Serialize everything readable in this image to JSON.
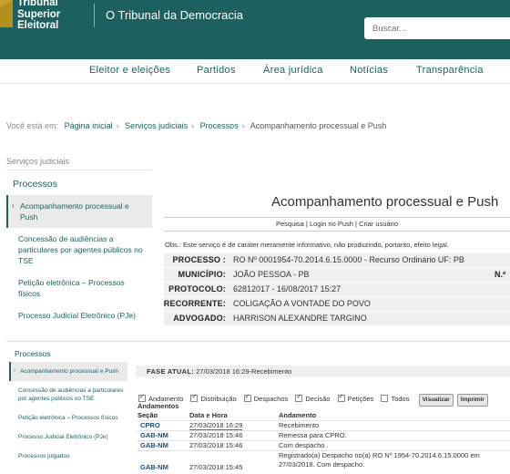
{
  "header": {
    "logo_lines": [
      "Tribunal",
      "Superior",
      "Eleitoral"
    ],
    "tagline": "O Tribunal da Democracia",
    "search_placeholder": "Buscar..."
  },
  "nav": [
    "Eleitor e eleições",
    "Partidos",
    "Área jurídica",
    "Notícias",
    "Transparência"
  ],
  "breadcrumb": {
    "prefix": "Você está em:",
    "items": [
      "Página inicial",
      "Serviços judiciais",
      "Processos",
      "Acompanhamento processual e Push"
    ]
  },
  "sidebar": {
    "section": "Serviços judiciais",
    "title": "Processos",
    "items": [
      "Acompanhamento processual e Push",
      "Concessão de audiências a particulares por agentes públicos no TSE",
      "Petição eletrônica – Processos físicos",
      "Processo Judicial Eletrônico (PJe)"
    ]
  },
  "main": {
    "title": "Acompanhamento processual e Push",
    "links": [
      "Pesquisa",
      "Login no Push",
      "Criar usuário"
    ],
    "obs": "Obs.: Este serviço é de caráter meramente informativo, não produzindo, portanto, efeito legal.",
    "rows": [
      {
        "label": "PROCESSO :",
        "value": "RO Nº 0001954-70.2014.6.15.0000 - Recurso Ordinário UF: PB"
      },
      {
        "label": "MUNICÍPIO:",
        "value": "JOÃO PESSOA - PB",
        "extra": "N.º"
      },
      {
        "label": "PROTOCOLO:",
        "value": "62812017 - 16/08/2017 15:27"
      },
      {
        "label": "RECORRENTE:",
        "value": "COLIGAÇÃO A VONTADE DO POVO"
      },
      {
        "label": "ADVOGADO:",
        "value": "HARRISON ALEXANDRE TARGINO"
      }
    ]
  },
  "lower": {
    "title": "Processos",
    "items": [
      "Acompanhamento processual e Push",
      "Concessão de audiências a particulares por agentes públicos no TSE",
      "Petição eletrônica – Processos físicos",
      "Processo Judicial Eletrônico (PJe)",
      "Processos julgados"
    ],
    "fase_label": "FASE ATUAL:",
    "fase_value": "27/03/2018 16:29-Recebimento",
    "filters": [
      "Andamento",
      "Distribuição",
      "Despachos",
      "Decisão",
      "Petições",
      "Todos"
    ],
    "filter_checked": [
      true,
      true,
      true,
      true,
      true,
      false
    ],
    "buttons": [
      "Visualizar",
      "Imprimir"
    ],
    "andamentos_title": "Andamentos",
    "columns": [
      "Seção",
      "Data e Hora",
      "Andamento"
    ],
    "rows": [
      {
        "secao": "CPRO",
        "data": "27/03/2018 16:29",
        "andamento": "Recebimento"
      },
      {
        "secao": "GAB-NM",
        "data": "27/03/2018 15:46",
        "andamento": "Remessa para CPRO."
      },
      {
        "secao": "GAB-NM",
        "data": "27/03/2018 15:46",
        "andamento": "Com despacho ."
      },
      {
        "secao": "GAB-NM",
        "data": "27/03/2018 15:45",
        "andamento": "Registrado(a) Despacho no(a) RO Nº 1954-70.2014.6.15.0000 em 27/03/2018. Com despacho."
      }
    ]
  },
  "colors": {
    "brand": "#1d6060",
    "gold": "#c9a227",
    "highlight": "#e8372a"
  }
}
